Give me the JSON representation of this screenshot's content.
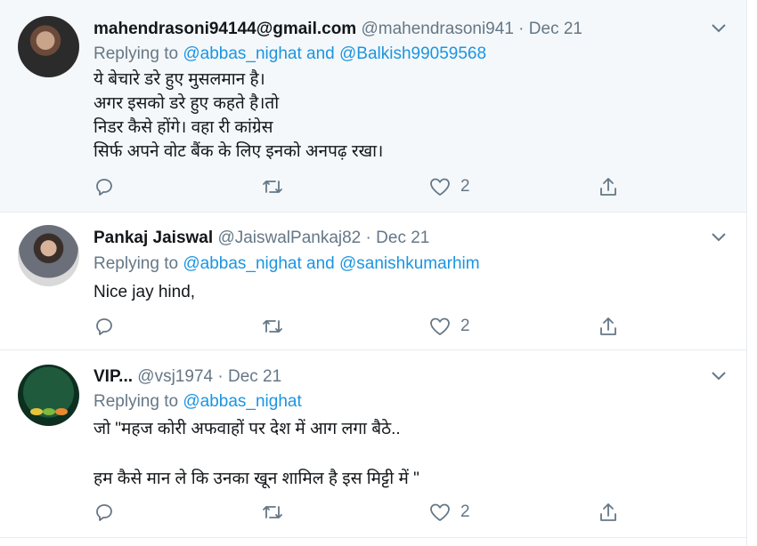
{
  "tweets": [
    {
      "name": "mahendrasoni94144@gmail.com",
      "handle": "@mahendrasoni941",
      "dot": "·",
      "date": "Dec 21",
      "replying_prefix": "Replying to",
      "replying_users": "@abbas_nighat and @Balkish99059568",
      "text": "ये बेचारे डरे हुए मुसलमान है।\nअगर इसको डरे हुए कहते है।तो\nनिडर कैसे होंगे। वहा री कांग्रेस\nसिर्फ अपने वोट बैंक के लिए इनको अनपढ़ रखा।",
      "like_count": "2"
    },
    {
      "name": "Pankaj Jaiswal",
      "handle": "@JaiswalPankaj82",
      "dot": "·",
      "date": "Dec 21",
      "replying_prefix": "Replying to",
      "replying_users": "@abbas_nighat and @sanishkumarhim",
      "text": "Nice jay hind,",
      "like_count": "2"
    },
    {
      "name": "VIP...",
      "handle": "@vsj1974",
      "dot": "·",
      "date": "Dec 21",
      "replying_prefix": "Replying to",
      "replying_users": "@abbas_nighat",
      "text": "जो \"महज कोरी अफवाहों पर देश में आग लगा बैठे..\n\nहम कैसे मान ले कि उनका खून शामिल है इस मिट्टी में \"",
      "like_count": "2"
    }
  ],
  "colors": {
    "text": "#14171a",
    "muted": "#657786",
    "link": "#1b95e0",
    "highlight_bg": "#f5f8fa"
  },
  "icons": [
    "reply-icon",
    "retweet-icon",
    "like-icon",
    "share-icon",
    "chevron-down-icon"
  ]
}
